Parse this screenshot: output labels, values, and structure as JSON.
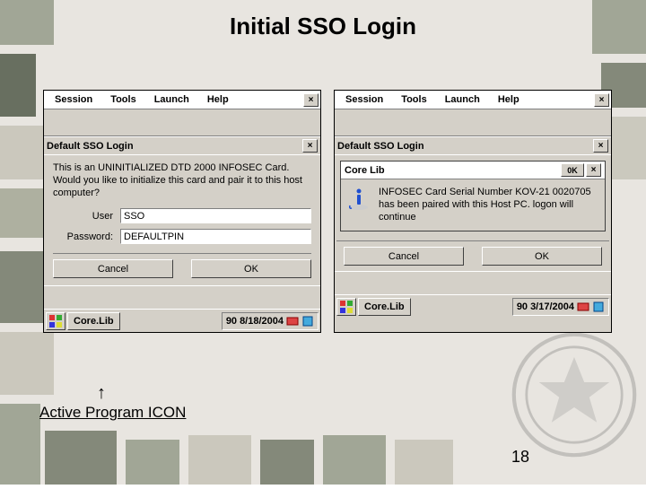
{
  "slide": {
    "title": "Initial SSO Login",
    "annotation": "Active Program ICON",
    "page": "18"
  },
  "menu": {
    "session": "Session",
    "tools": "Tools",
    "launch": "Launch",
    "help": "Help",
    "close": "×"
  },
  "windows": {
    "left": {
      "dlg_title": "Default SSO Login",
      "close": "×",
      "message": "This is an UNINITIALIZED DTD 2000 INFOSEC Card.  Would you like to initialize this card and pair it to this host computer?",
      "user_label": "User",
      "user_value": "SSO",
      "pass_label": "Password:",
      "pass_value": "DEFAULTPIN",
      "cancel": "Cancel",
      "ok": "OK",
      "task_label": "Core.Lib",
      "tray_num": "90",
      "date": "8/18/2004"
    },
    "right": {
      "dlg_title": "Default SSO Login",
      "close": "×",
      "inner_title": "Core Lib",
      "inner_ok": "0K",
      "inner_close": "×",
      "inner_msg": "INFOSEC Card Serial Number KOV-21 0020705 has been paired with this Host PC. logon will continue",
      "cancel": "Cancel",
      "ok": "OK",
      "task_label": "Core.Lib",
      "tray_num": "90",
      "date": "3/17/2004"
    }
  }
}
